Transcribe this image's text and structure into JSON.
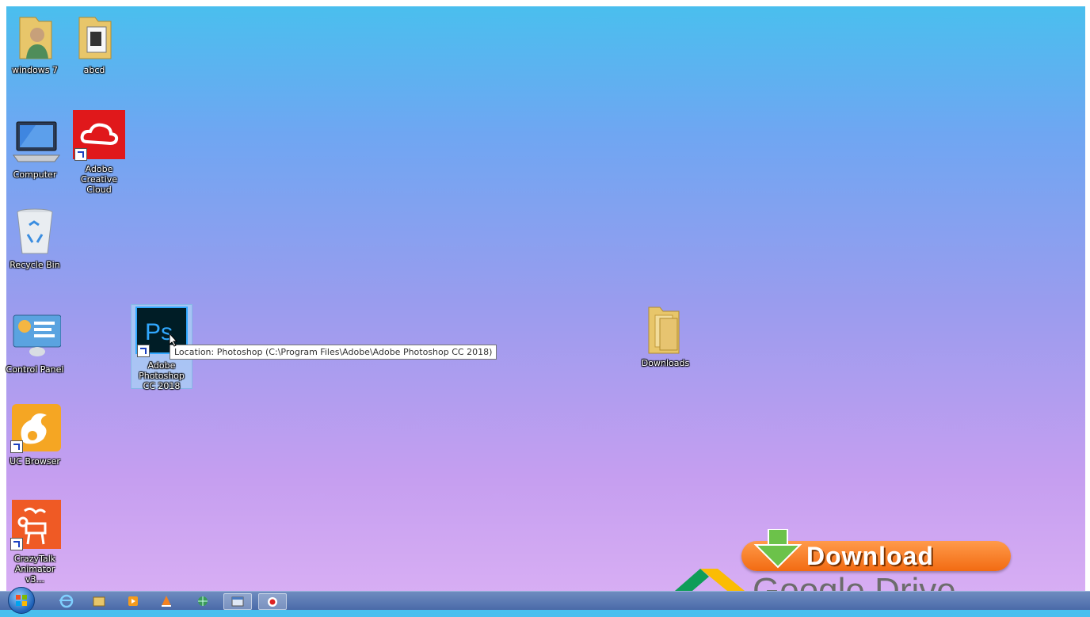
{
  "desktop": {
    "icons": [
      {
        "label": "windows 7"
      },
      {
        "label": "abcd"
      },
      {
        "label": "Computer"
      },
      {
        "label": "Adobe Creative Cloud"
      },
      {
        "label": "Recycle Bin"
      },
      {
        "label": "Control Panel"
      },
      {
        "label": "Adobe Photoshop CC 2018"
      },
      {
        "label": "Downloads"
      },
      {
        "label": "UC Browser"
      },
      {
        "label": "CrazyTalk Animator v3..."
      }
    ],
    "tooltip": "Location: Photoshop (C:\\Program Files\\Adobe\\Adobe Photoshop CC 2018)"
  },
  "overlay": {
    "download_label": "Download",
    "drive_label": "Google Drive",
    "brand_colors": {
      "orange": "#f26b12",
      "green": "#6cc24a"
    }
  },
  "taskbar": {
    "items": [
      {
        "icon": "internet-explorer-icon"
      },
      {
        "icon": "file-explorer-icon"
      },
      {
        "icon": "media-player-icon"
      },
      {
        "icon": "vlc-icon"
      },
      {
        "icon": "network-icon"
      },
      {
        "icon": "window-icon"
      },
      {
        "icon": "screen-recorder-icon"
      }
    ]
  }
}
